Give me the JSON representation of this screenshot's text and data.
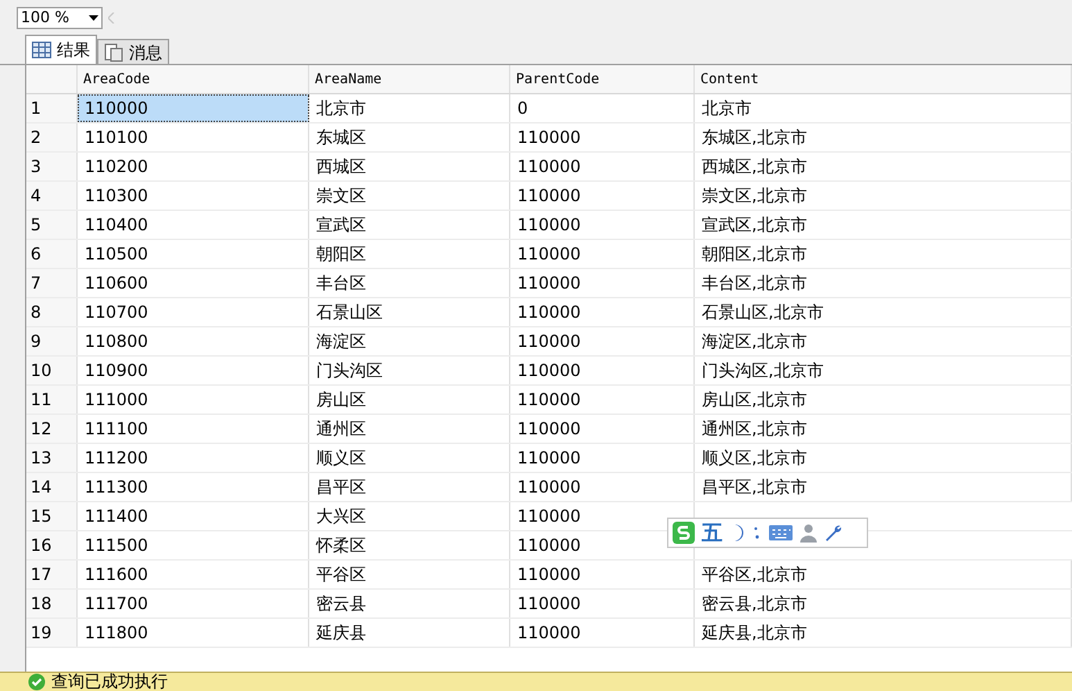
{
  "zoom": {
    "value": "100 %"
  },
  "tabs": [
    {
      "label": "结果",
      "selected": true
    },
    {
      "label": "消息",
      "selected": false
    }
  ],
  "table": {
    "columns": [
      "AreaCode",
      "AreaName",
      "ParentCode",
      "Content"
    ],
    "rows": [
      {
        "num": "1",
        "cells": [
          "110000",
          "北京市",
          "0",
          "北京市"
        ],
        "selected": true
      },
      {
        "num": "2",
        "cells": [
          "110100",
          "东城区",
          "110000",
          "东城区,北京市"
        ],
        "selected": false
      },
      {
        "num": "3",
        "cells": [
          "110200",
          "西城区",
          "110000",
          "西城区,北京市"
        ],
        "selected": false
      },
      {
        "num": "4",
        "cells": [
          "110300",
          "崇文区",
          "110000",
          "崇文区,北京市"
        ],
        "selected": false
      },
      {
        "num": "5",
        "cells": [
          "110400",
          "宣武区",
          "110000",
          "宣武区,北京市"
        ],
        "selected": false
      },
      {
        "num": "6",
        "cells": [
          "110500",
          "朝阳区",
          "110000",
          "朝阳区,北京市"
        ],
        "selected": false
      },
      {
        "num": "7",
        "cells": [
          "110600",
          "丰台区",
          "110000",
          "丰台区,北京市"
        ],
        "selected": false
      },
      {
        "num": "8",
        "cells": [
          "110700",
          "石景山区",
          "110000",
          "石景山区,北京市"
        ],
        "selected": false
      },
      {
        "num": "9",
        "cells": [
          "110800",
          "海淀区",
          "110000",
          "海淀区,北京市"
        ],
        "selected": false
      },
      {
        "num": "10",
        "cells": [
          "110900",
          "门头沟区",
          "110000",
          "门头沟区,北京市"
        ],
        "selected": false
      },
      {
        "num": "11",
        "cells": [
          "111000",
          "房山区",
          "110000",
          "房山区,北京市"
        ],
        "selected": false
      },
      {
        "num": "12",
        "cells": [
          "111100",
          "通州区",
          "110000",
          "通州区,北京市"
        ],
        "selected": false
      },
      {
        "num": "13",
        "cells": [
          "111200",
          "顺义区",
          "110000",
          "顺义区,北京市"
        ],
        "selected": false
      },
      {
        "num": "14",
        "cells": [
          "111300",
          "昌平区",
          "110000",
          "昌平区,北京市"
        ],
        "selected": false
      },
      {
        "num": "15",
        "cells": [
          "111400",
          "大兴区",
          "110000"
        ],
        "selected": false
      },
      {
        "num": "16",
        "cells": [
          "111500",
          "怀柔区",
          "110000"
        ],
        "selected": false
      },
      {
        "num": "17",
        "cells": [
          "111600",
          "平谷区",
          "110000",
          "平谷区,北京市"
        ],
        "selected": false
      },
      {
        "num": "18",
        "cells": [
          "111700",
          "密云县",
          "110000",
          "密云县,北京市"
        ],
        "selected": false
      },
      {
        "num": "19",
        "cells": [
          "111800",
          "延庆县",
          "110000",
          "延庆县,北京市"
        ],
        "selected": false
      }
    ]
  },
  "ime_toolbar": {
    "mode": "五"
  },
  "status_bar": {
    "message": "查询已成功执行"
  }
}
